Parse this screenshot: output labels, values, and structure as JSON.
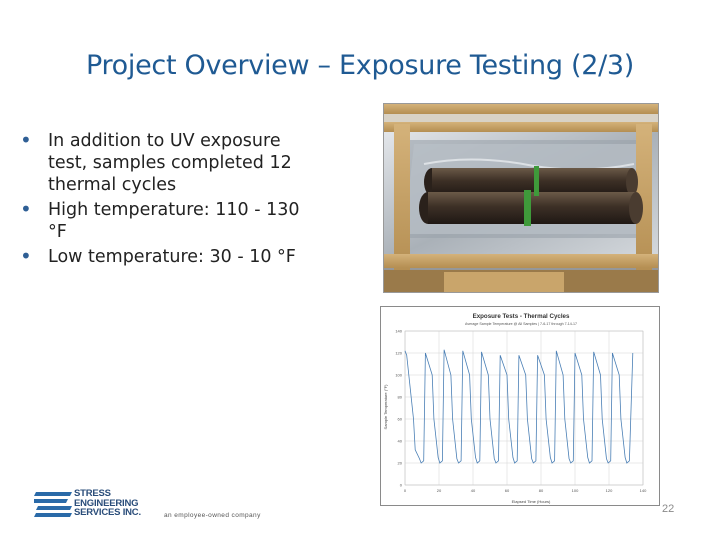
{
  "slide": {
    "title": "Project Overview – Exposure Testing (2/3)",
    "bullets": [
      "In addition to UV exposure test, samples completed 12 thermal cycles",
      "High temperature: 110 - 130 °F",
      "Low temperature: 30 - 10 °F"
    ],
    "page_number": "22"
  },
  "logo": {
    "line1": "STRESS",
    "line2": "ENGINEERING",
    "line3": "SERVICES INC.",
    "tagline": "an employee-owned company"
  },
  "chart_data": {
    "type": "line",
    "title": "Exposure Tests - Thermal Cycles",
    "subtitle": "Average Sample Temperature @ All Samples | 7-6-17 through 7-14-17",
    "xlabel": "Elapsed Time (Hours)",
    "ylabel": "Sample Temperature (°F)",
    "xlim": [
      0,
      140
    ],
    "ylim": [
      0,
      140
    ],
    "xticks": [
      "0",
      "20",
      "40",
      "60",
      "80",
      "100",
      "120",
      "140"
    ],
    "yticks": [
      "0",
      "20",
      "40",
      "60",
      "80",
      "100",
      "120",
      "140"
    ],
    "grid": true,
    "series": [
      {
        "color": "#4a7fb5",
        "x": [
          0,
          1,
          5,
          6,
          8.5,
          9.5,
          11,
          12,
          16,
          17,
          19.5,
          20.5,
          22,
          23,
          27,
          28,
          30.5,
          31.5,
          33,
          34,
          38,
          39,
          41.5,
          42.5,
          44,
          45,
          49,
          50,
          52.5,
          53.5,
          55,
          56,
          60,
          61,
          63.5,
          64.5,
          66,
          67,
          71,
          72,
          74.5,
          75.5,
          77,
          78,
          82,
          83,
          85.5,
          86.5,
          88,
          89,
          93,
          94,
          96.5,
          97.5,
          99,
          100,
          104,
          105,
          107.5,
          108.5,
          110,
          111,
          115,
          116,
          118.5,
          119.5,
          121,
          122,
          126,
          127,
          129.5,
          130.5,
          132,
          134
        ],
        "y": [
          122,
          118,
          60,
          32,
          24,
          20,
          22,
          120,
          100,
          60,
          25,
          20,
          22,
          123,
          100,
          60,
          24,
          20,
          22,
          122,
          100,
          60,
          25,
          20,
          22,
          121,
          100,
          60,
          24,
          20,
          22,
          118,
          100,
          60,
          25,
          20,
          22,
          118,
          100,
          60,
          24,
          20,
          22,
          118,
          100,
          60,
          25,
          20,
          22,
          122,
          100,
          60,
          24,
          20,
          22,
          120,
          100,
          60,
          25,
          20,
          22,
          121,
          100,
          60,
          24,
          20,
          22,
          120,
          100,
          60,
          25,
          20,
          22,
          120
        ]
      }
    ]
  },
  "colors": {
    "title": "#1f5a93",
    "bullet": "#2f5f95",
    "chart_line": "#4a7fb5",
    "logo": "#2a4d7a"
  }
}
